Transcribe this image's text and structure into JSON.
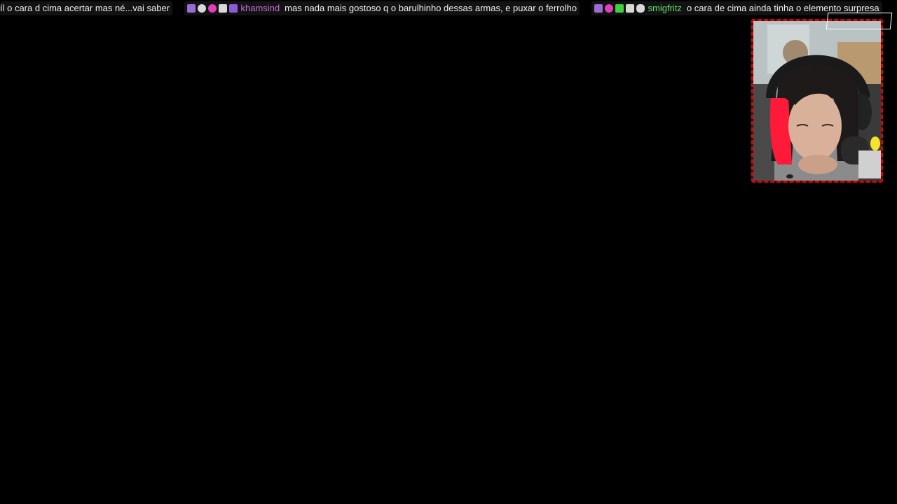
{
  "ticker": {
    "messages": [
      {
        "username": "",
        "username_color": "",
        "badges": [],
        "text": "íl o cara d cima acertar mas né...vai saber"
      },
      {
        "username": "khamsind",
        "username_color": "#c86be0",
        "badges": [
          {
            "icon": "chat-badge-icon",
            "color": "#9b6bd4"
          },
          {
            "icon": "hand-badge-icon",
            "color": "#d8d8d8"
          },
          {
            "icon": "heart-badge-icon",
            "color": "#e03fb8"
          },
          {
            "icon": "person-badge-icon",
            "color": "#d8d8d8"
          },
          {
            "icon": "sub-badge-icon",
            "color": "#8a5bd4"
          }
        ],
        "text": "mas nada mais gostoso q o barulhinho dessas armas, e puxar o ferrolho"
      },
      {
        "username": "smigfritz",
        "username_color": "#5fdc6a",
        "badges": [
          {
            "icon": "chat-badge-icon",
            "color": "#9b6bd4"
          },
          {
            "icon": "ribbon-badge-icon",
            "color": "#e03fb8"
          },
          {
            "icon": "check-badge-icon",
            "color": "#3fcf3f"
          },
          {
            "icon": "person-badge-icon",
            "color": "#d8d8d8"
          },
          {
            "icon": "bunny-badge-icon",
            "color": "#d8d8d8"
          }
        ],
        "text": "o cara de cima ainda tinha o elemento surpresa"
      }
    ]
  },
  "webcam": {
    "border_color": "#e00000",
    "hair_accent_color": "#ff1a3a"
  }
}
